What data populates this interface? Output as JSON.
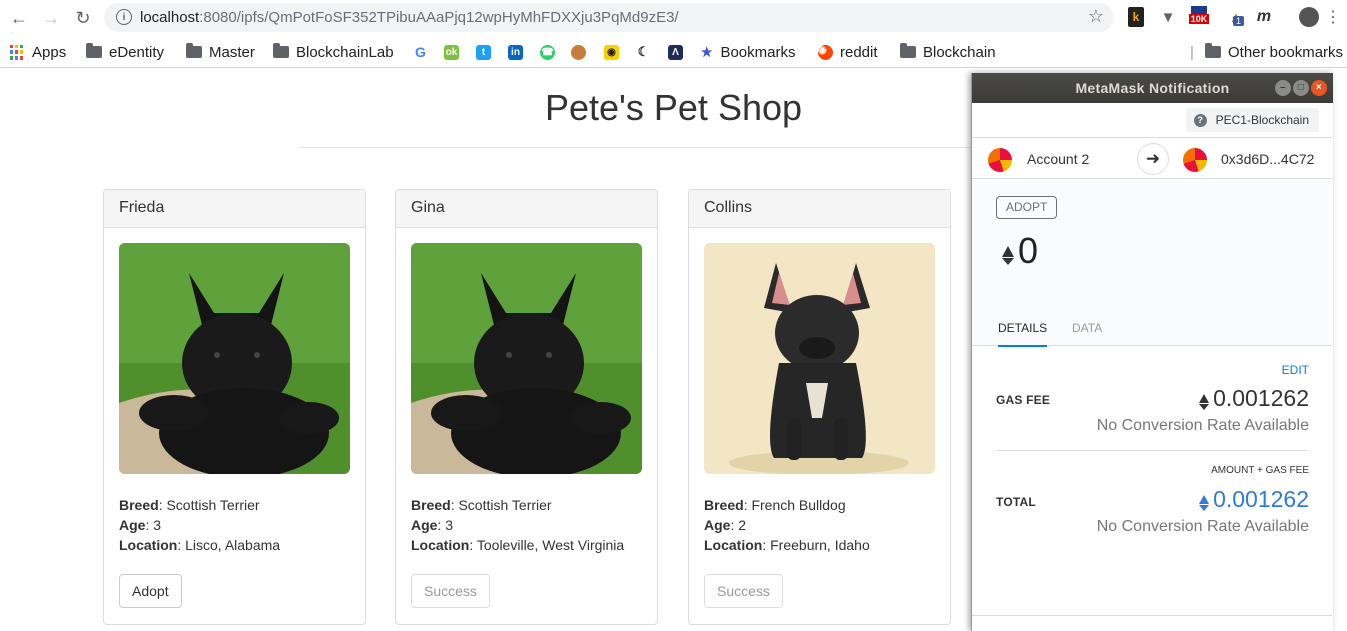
{
  "browser": {
    "url_host": "localhost",
    "url_rest": ":8080/ipfs/QmPotFoSF352TPibuAAaPjq12wpHyMhFDXXju3PqMd9zE3/",
    "extension_badge_10k": "10K",
    "extension_badge_1": "1"
  },
  "bookmarks": {
    "apps": "Apps",
    "items": [
      "eDentity",
      "Master",
      "BlockchainLab",
      "Bookmarks",
      "reddit",
      "Blockchain"
    ],
    "other": "Other bookmarks"
  },
  "shop": {
    "title": "Pete's Pet Shop",
    "labels": {
      "breed": "Breed",
      "age": "Age",
      "location": "Location"
    },
    "pets": [
      {
        "name": "Frieda",
        "breed": "Scottish Terrier",
        "age": "3",
        "location": "Lisco, Alabama",
        "button": "Adopt"
      },
      {
        "name": "Gina",
        "breed": "Scottish Terrier",
        "age": "3",
        "location": "Tooleville, West Virginia",
        "button": "Success"
      },
      {
        "name": "Collins",
        "breed": "French Bulldog",
        "age": "2",
        "location": "Freeburn, Idaho",
        "button": "Success"
      }
    ]
  },
  "metamask": {
    "title": "MetaMask Notification",
    "network": "PEC1-Blockchain",
    "from_account": "Account 2",
    "to_address": "0x3d6D...4C72",
    "method_badge": "ADOPT",
    "amount": "0",
    "tabs": [
      "DETAILS",
      "DATA"
    ],
    "edit": "EDIT",
    "gas_fee_label": "GAS FEE",
    "gas_fee_value": "0.001262",
    "no_conversion": "No Conversion Rate Available",
    "amount_plus_gas": "AMOUNT + GAS FEE",
    "total_label": "TOTAL",
    "total_value": "0.001262",
    "colors": {
      "accent": "#037dd6",
      "total": "#2f7bd8",
      "titlebar": "#3c3b37"
    }
  }
}
